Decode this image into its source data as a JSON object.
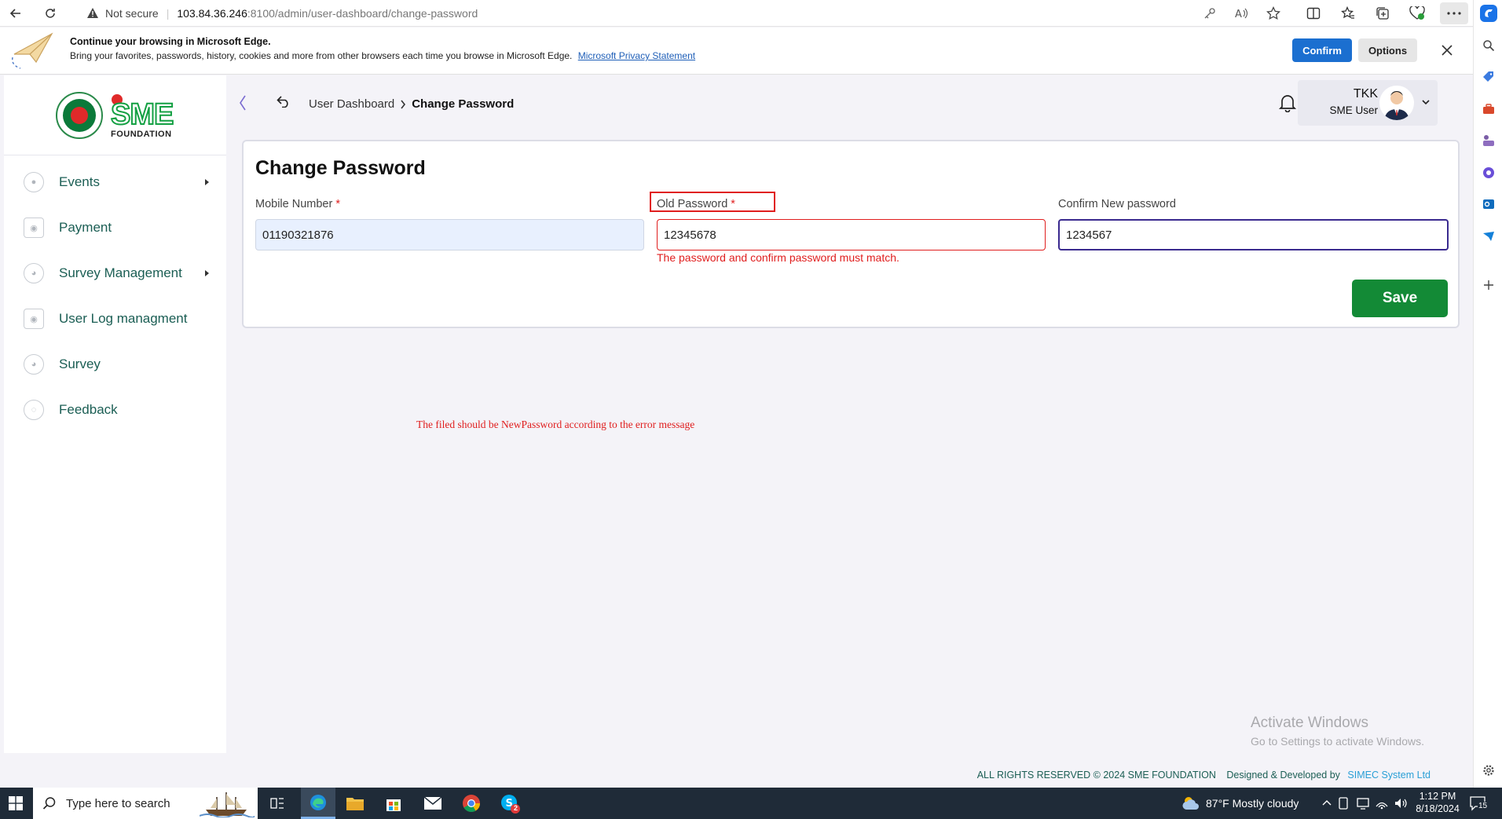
{
  "browser": {
    "security_label": "Not secure",
    "url_host": "103.84.36.246",
    "url_rest": ":8100/admin/user-dashboard/change-password"
  },
  "infobar": {
    "title": "Continue your browsing in Microsoft Edge.",
    "body": "Bring your favorites, passwords, history, cookies and more from other browsers each time you browse in Microsoft Edge.",
    "link": "Microsoft Privacy Statement",
    "confirm_label": "Confirm",
    "options_label": "Options"
  },
  "logo": {
    "main": "SME",
    "sub": "FOUNDATION"
  },
  "sidebar": {
    "items": [
      {
        "label": "Events"
      },
      {
        "label": "Payment"
      },
      {
        "label": "Survey Management"
      },
      {
        "label": "User Log managment"
      },
      {
        "label": "Survey"
      },
      {
        "label": "Feedback"
      }
    ]
  },
  "breadcrumb": {
    "parent": "User Dashboard",
    "current": "Change Password"
  },
  "user": {
    "name": "TKK",
    "role": "SME User"
  },
  "form": {
    "title": "Change Password",
    "mobile_label": "Mobile Number",
    "mobile_value": "01190321876",
    "old_label": "Old Password",
    "old_value": "12345678",
    "confirm_label": "Confirm New password",
    "confirm_value": "1234567",
    "required_mark": "*",
    "error": "The password and confirm password must match.",
    "save_label": "Save"
  },
  "annotation": "The filed should be NewPassword according to the error message",
  "watermark": {
    "title": "Activate Windows",
    "sub": "Go to Settings to activate Windows."
  },
  "footer": {
    "rights": "ALL RIGHTS RESERVED © 2024 SME FOUNDATION",
    "designed": "Designed & Developed by",
    "company": "SIMEC System Ltd"
  },
  "taskbar": {
    "search_placeholder": "Type here to search",
    "weather": "87°F  Mostly cloudy",
    "time": "1:12 PM",
    "date": "8/18/2024",
    "notif_count": "15",
    "skype_badge": "2"
  },
  "colors": {
    "accent_green": "#138a36",
    "error_red": "#e01e1e",
    "focus_purple": "#3a2a8f",
    "edge_blue": "#1b6fd0"
  }
}
